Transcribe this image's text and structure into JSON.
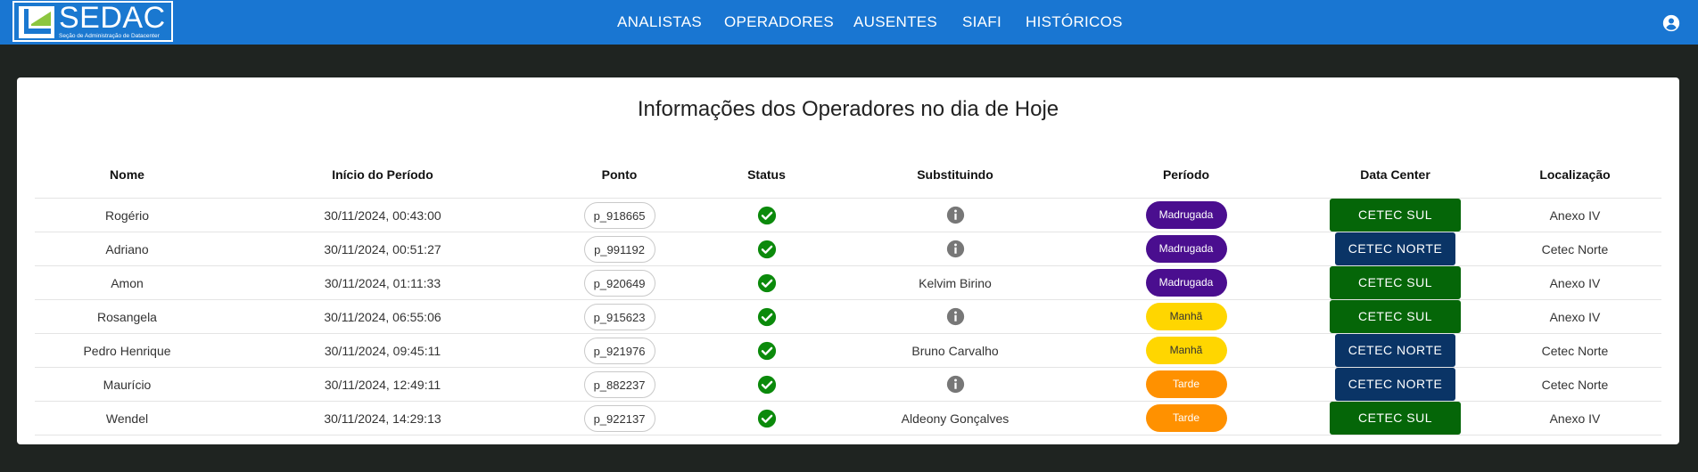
{
  "app": {
    "logo_text": "SEDAC",
    "logo_subtitle": "Seção de Administração de Datacenter"
  },
  "nav": {
    "items": [
      {
        "label": "ANALISTAS"
      },
      {
        "label": "OPERADORES"
      },
      {
        "label": "AUSENTES"
      },
      {
        "label": "SIAFI"
      },
      {
        "label": "HISTÓRICOS"
      }
    ]
  },
  "colors": {
    "topbar": "#1976d2",
    "madrugada": "#4a0e8f",
    "manha": "#ffd600",
    "tarde": "#ff9100",
    "cetec_sul": "#056608",
    "cetec_norte": "#0a3466",
    "status_ok": "#0b8a0b",
    "info_icon": "#777777"
  },
  "card": {
    "title": "Informações dos Operadores no dia de Hoje"
  },
  "table": {
    "headers": [
      "Nome",
      "Início do Período",
      "Ponto",
      "Status",
      "Substituindo",
      "Período",
      "Data Center",
      "Localização"
    ],
    "rows": [
      {
        "nome": "Rogério",
        "inicio": "30/11/2024, 00:43:00",
        "ponto": "p_918665",
        "status": "check-circle-icon",
        "substituindo": "",
        "periodo": "Madrugada",
        "datacenter": "CETEC SUL",
        "localizacao": "Anexo IV"
      },
      {
        "nome": "Adriano",
        "inicio": "30/11/2024, 00:51:27",
        "ponto": "p_991192",
        "status": "check-circle-icon",
        "substituindo": "",
        "periodo": "Madrugada",
        "datacenter": "CETEC NORTE",
        "localizacao": "Cetec Norte"
      },
      {
        "nome": "Amon",
        "inicio": "30/11/2024, 01:11:33",
        "ponto": "p_920649",
        "status": "check-circle-icon",
        "substituindo": "Kelvim Birino",
        "periodo": "Madrugada",
        "datacenter": "CETEC SUL",
        "localizacao": "Anexo IV"
      },
      {
        "nome": "Rosangela",
        "inicio": "30/11/2024, 06:55:06",
        "ponto": "p_915623",
        "status": "check-circle-icon",
        "substituindo": "",
        "periodo": "Manhã",
        "datacenter": "CETEC SUL",
        "localizacao": "Anexo IV"
      },
      {
        "nome": "Pedro Henrique",
        "inicio": "30/11/2024, 09:45:11",
        "ponto": "p_921976",
        "status": "check-circle-icon",
        "substituindo": "Bruno Carvalho",
        "periodo": "Manhã",
        "datacenter": "CETEC NORTE",
        "localizacao": "Cetec Norte"
      },
      {
        "nome": "Maurício",
        "inicio": "30/11/2024, 12:49:11",
        "ponto": "p_882237",
        "status": "check-circle-icon",
        "substituindo": "",
        "periodo": "Tarde",
        "datacenter": "CETEC NORTE",
        "localizacao": "Cetec Norte"
      },
      {
        "nome": "Wendel",
        "inicio": "30/11/2024, 14:29:13",
        "ponto": "p_922137",
        "status": "check-circle-icon",
        "substituindo": "Aldeony Gonçalves",
        "periodo": "Tarde",
        "datacenter": "CETEC SUL",
        "localizacao": "Anexo IV"
      }
    ]
  },
  "icons": {
    "account": "account-circle-icon",
    "status_ok": "check-circle-icon",
    "no_substitute": "info-icon"
  }
}
